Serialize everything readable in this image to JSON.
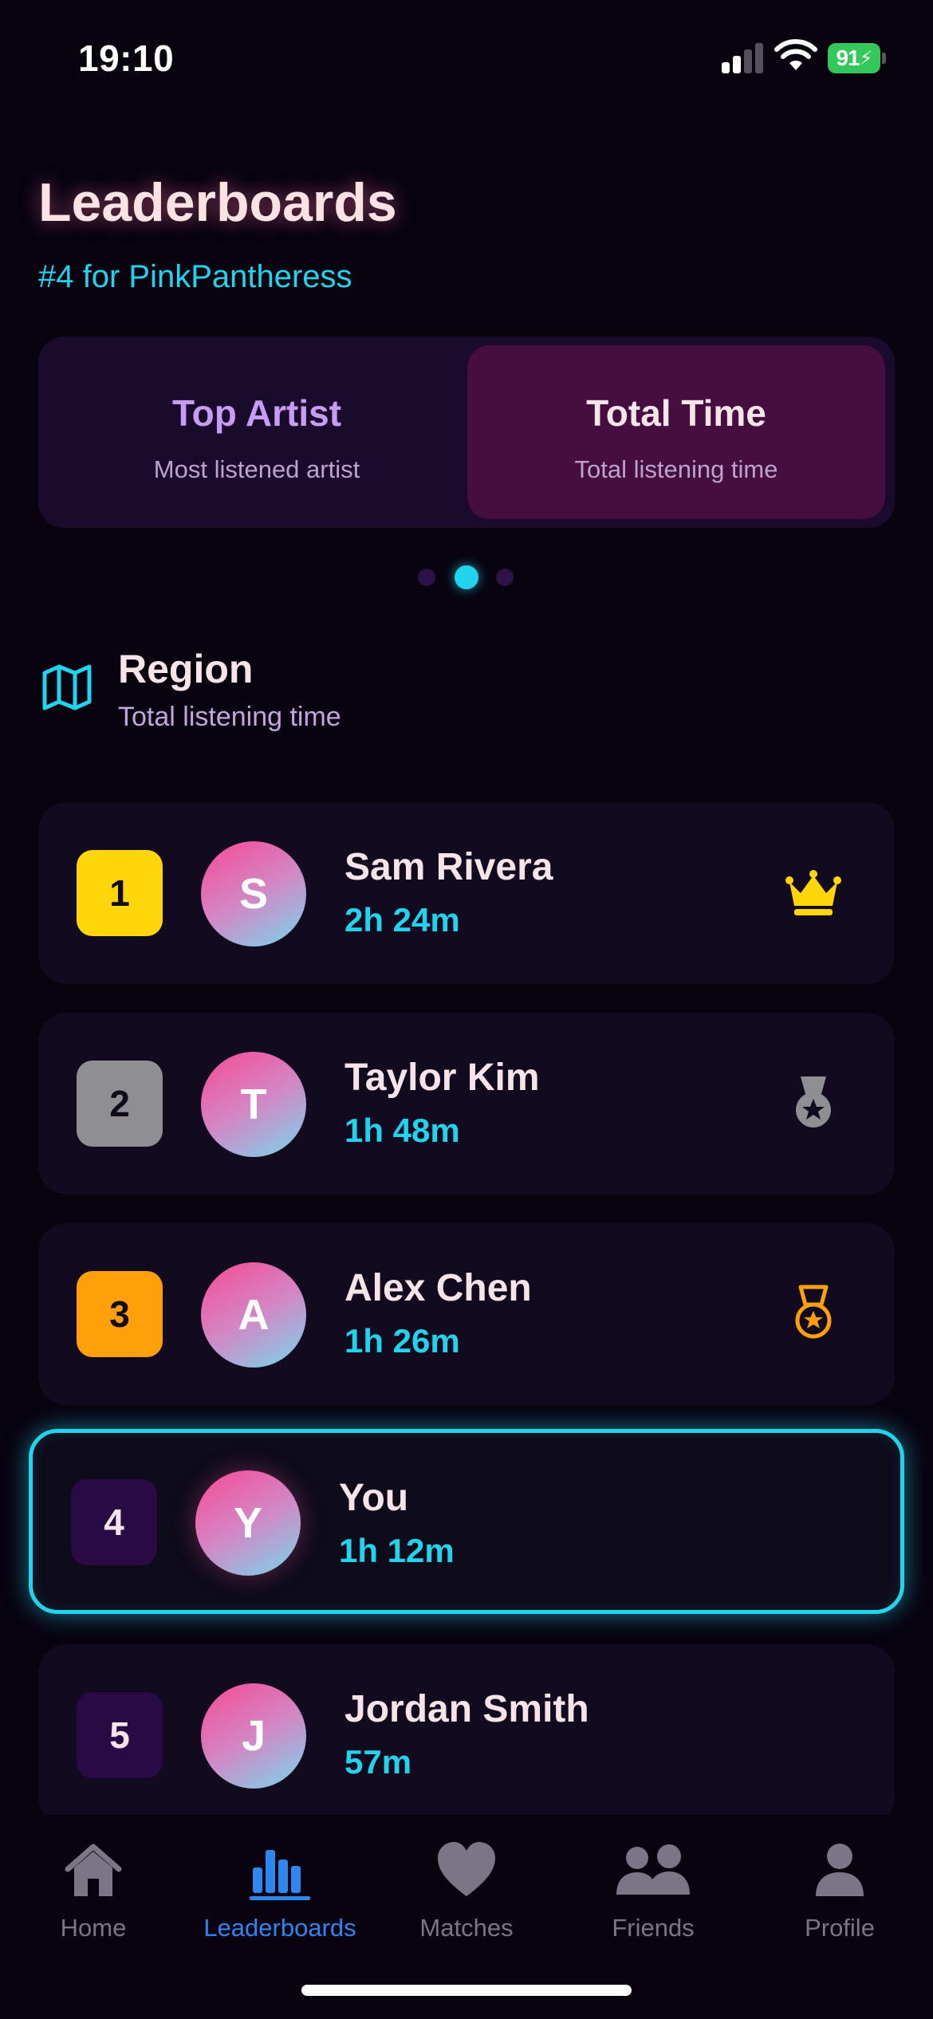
{
  "status_bar": {
    "time": "19:10",
    "battery": "91"
  },
  "header": {
    "title": "Leaderboards",
    "subtitle": "#4 for PinkPantheress"
  },
  "categories": [
    {
      "title": "Top Artist",
      "subtitle": "Most listened artist",
      "selected": false
    },
    {
      "title": "Total Time",
      "subtitle": "Total listening time",
      "selected": true
    }
  ],
  "pager": {
    "count": 3,
    "active_index": 1
  },
  "section": {
    "title": "Region",
    "subtitle": "Total listening time",
    "icon": "map-icon"
  },
  "leaderboard": [
    {
      "rank": "1",
      "initial": "S",
      "name": "Sam Rivera",
      "time": "2h 24m",
      "rank_color": "#ffd60a",
      "badge_icon": "crown-icon"
    },
    {
      "rank": "2",
      "initial": "T",
      "name": "Taylor Kim",
      "time": "1h 48m",
      "rank_color": "#8e8e93",
      "badge_icon": "silver-medal-icon"
    },
    {
      "rank": "3",
      "initial": "A",
      "name": "Alex Chen",
      "time": "1h 26m",
      "rank_color": "#ff9f0a",
      "badge_icon": "bronze-medal-icon"
    },
    {
      "rank": "4",
      "initial": "Y",
      "name": "You",
      "time": "1h 12m",
      "rank_color": "#2a0a45",
      "highlighted": true
    },
    {
      "rank": "5",
      "initial": "J",
      "name": "Jordan Smith",
      "time": "57m",
      "rank_color": "#2a0a45"
    }
  ],
  "tabs": [
    {
      "label": "Home",
      "icon": "house-icon"
    },
    {
      "label": "Leaderboards",
      "icon": "bar-chart-icon",
      "active": true
    },
    {
      "label": "Matches",
      "icon": "heart-icon"
    },
    {
      "label": "Friends",
      "icon": "people-icon"
    },
    {
      "label": "Profile",
      "icon": "person-icon"
    }
  ],
  "colors": {
    "accent": "#22d3ee",
    "tab_active": "#2e86f0",
    "background": "#08030f"
  }
}
